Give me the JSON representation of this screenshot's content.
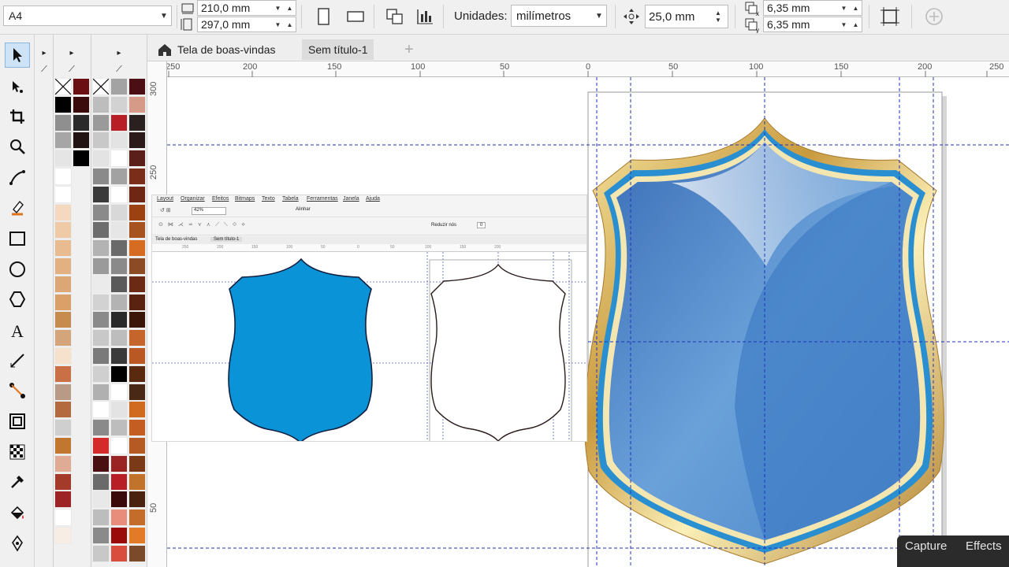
{
  "propbar": {
    "page_size": "A4",
    "width": "210,0 mm",
    "height": "297,0 mm",
    "units_label": "Unidades:",
    "units_value": "milímetros",
    "nudge": "25,0 mm",
    "dup_x": "6,35 mm",
    "dup_y": "6,35 mm"
  },
  "tabs": [
    {
      "label": "Tela de boas-vindas"
    },
    {
      "label": "Sem título-1"
    }
  ],
  "tab_add": "+",
  "hruler_labels": [
    "250",
    "200",
    "150",
    "100",
    "50",
    "0",
    "50",
    "100",
    "150",
    "200",
    "250"
  ],
  "vruler_labels": [
    "300",
    "250",
    "50"
  ],
  "inset": {
    "menu": [
      "Layout",
      "Organizar",
      "Efeitos",
      "Bitmaps",
      "Texto",
      "Tabela",
      "Ferramentas",
      "Janela",
      "Ajuda"
    ],
    "zoom": "42%",
    "align": "Alinhar",
    "reduce_nodes": "Reduzir nós",
    "reduce_value": "0",
    "tabs": [
      "Tela de boas-vindas",
      "Sem título-1"
    ],
    "ruler": [
      "250",
      "200",
      "150",
      "100",
      "50",
      "0",
      "50",
      "100",
      "150",
      "200"
    ]
  },
  "capture_bar": {
    "capture": "Capture",
    "effects": "Effects"
  },
  "colors": {
    "shield_fill": "#0a93d6",
    "shield_glass_top": "#5e98d6",
    "shield_glass_bottom": "#3d78c2",
    "gold": "#c9a24a",
    "guide": "#2233bb"
  }
}
